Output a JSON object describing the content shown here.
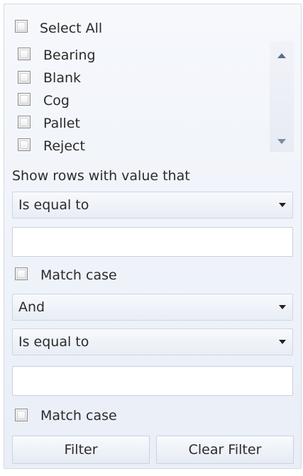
{
  "select_all": {
    "label": "Select All",
    "checked": false
  },
  "values": [
    {
      "label": "Bearing",
      "checked": false
    },
    {
      "label": "Blank",
      "checked": false
    },
    {
      "label": "Cog",
      "checked": false
    },
    {
      "label": "Pallet",
      "checked": false
    },
    {
      "label": "Reject",
      "checked": false
    }
  ],
  "scrollbar": {
    "up_icon": "triangle-up",
    "down_icon": "triangle-down"
  },
  "condition_heading": "Show rows with value that",
  "filter1": {
    "operator": "Is equal to",
    "value": "",
    "match_case_label": "Match case",
    "match_case_checked": false
  },
  "logical_operator": "And",
  "filter2": {
    "operator": "Is equal to",
    "value": "",
    "match_case_label": "Match case",
    "match_case_checked": false
  },
  "buttons": {
    "filter": "Filter",
    "clear_filter": "Clear Filter"
  },
  "colors": {
    "panel": "#eef2f8",
    "border": "#d3d9e4",
    "text": "#2b2b2b"
  }
}
